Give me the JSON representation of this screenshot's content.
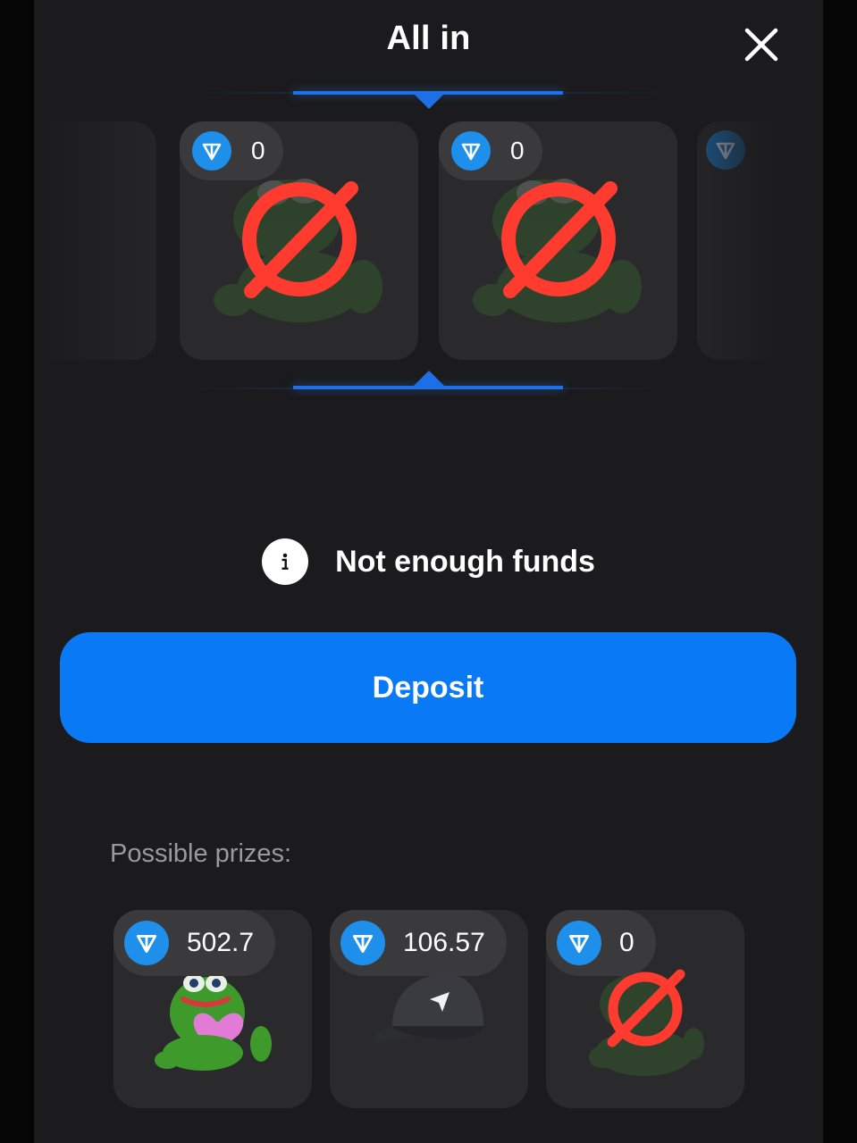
{
  "modal": {
    "title": "All in"
  },
  "reel": {
    "items": [
      {
        "value": "0",
        "item": "empty-prize"
      },
      {
        "value": "0",
        "item": "empty-prize"
      }
    ]
  },
  "status": {
    "message": "Not enough funds"
  },
  "actions": {
    "deposit_label": "Deposit"
  },
  "prizes": {
    "label": "Possible prizes:",
    "items": [
      {
        "value": "502.7",
        "item": "pepe-heart"
      },
      {
        "value": "106.57",
        "item": "cap"
      },
      {
        "value": "0",
        "item": "empty-prize"
      }
    ]
  },
  "colors": {
    "accent": "#0a79f6",
    "ton": "#1e8fea",
    "background": "#1b1b1d",
    "card": "#2a2a2c",
    "empty_mark": "#ff3b30"
  }
}
